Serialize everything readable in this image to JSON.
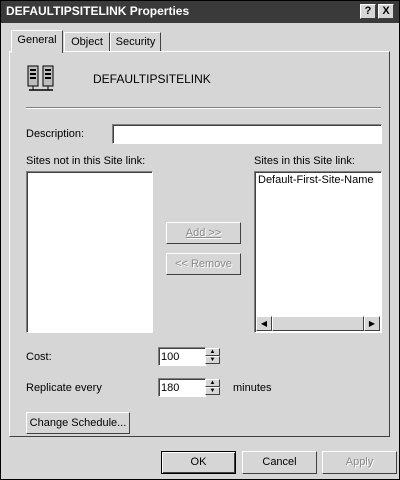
{
  "window": {
    "title": "DEFAULTIPSITELINK Properties",
    "help_glyph": "?",
    "close_glyph": "X"
  },
  "tabs": [
    {
      "label": "General",
      "active": true
    },
    {
      "label": "Object",
      "active": false
    },
    {
      "label": "Security",
      "active": false
    }
  ],
  "general": {
    "object_name": "DEFAULTIPSITELINK",
    "icon": "site-link-icon",
    "description_label": "Description:",
    "description_value": "",
    "sites_not_in_label": "Sites not in this Site link:",
    "sites_not_in_items": [],
    "sites_in_label": "Sites in this Site link:",
    "sites_in_items": [
      "Default-First-Site-Name"
    ],
    "add_button": "Add >>",
    "remove_button": "<< Remove",
    "cost_label": "Cost:",
    "cost_value": "100",
    "replicate_label": "Replicate every",
    "replicate_value": "180",
    "replicate_unit": "minutes",
    "change_schedule_button": "Change Schedule..."
  },
  "footer": {
    "ok": "OK",
    "cancel": "Cancel",
    "apply": "Apply"
  },
  "colors": {
    "titlebar": "#3a3a3a",
    "face": "#d6d6d6",
    "disabled_text": "#8a8a8a"
  }
}
